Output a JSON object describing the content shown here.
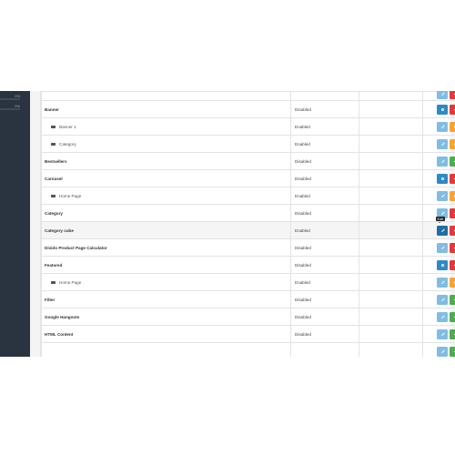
{
  "sidebar": {
    "progress": [
      {
        "label": "0%",
        "value": 0
      },
      {
        "label": "0%",
        "value": 0
      }
    ]
  },
  "modules": [
    {
      "name": "",
      "status": "",
      "type": "top",
      "buttons": [
        "edit",
        "uninstall"
      ]
    },
    {
      "name": "Banner",
      "status": "Disabled",
      "type": "module",
      "buttons": [
        "add",
        "uninstall"
      ]
    },
    {
      "name": "Banner 1",
      "status": "Enabled",
      "type": "child",
      "buttons": [
        "edit",
        "delete"
      ]
    },
    {
      "name": "Category",
      "status": "Enabled",
      "type": "child",
      "buttons": [
        "edit",
        "delete"
      ]
    },
    {
      "name": "Bestsellers",
      "status": "Disabled",
      "type": "module",
      "buttons": [
        "edit",
        "install"
      ]
    },
    {
      "name": "Carousel",
      "status": "Disabled",
      "type": "module",
      "buttons": [
        "add",
        "uninstall"
      ]
    },
    {
      "name": "Home Page",
      "status": "Enabled",
      "type": "child",
      "buttons": [
        "edit",
        "delete"
      ]
    },
    {
      "name": "Category",
      "status": "Disabled",
      "type": "module",
      "buttons": [
        "edit",
        "uninstall"
      ]
    },
    {
      "name": "Category cube",
      "status": "Enabled",
      "type": "module",
      "highlight": true,
      "tooltip": "Edit",
      "buttons": [
        "edit-active",
        "uninstall"
      ]
    },
    {
      "name": "Divido Product Page Calculator",
      "status": "Disabled",
      "type": "module",
      "buttons": [
        "edit",
        "uninstall"
      ]
    },
    {
      "name": "Featured",
      "status": "Disabled",
      "type": "module",
      "buttons": [
        "add",
        "uninstall"
      ]
    },
    {
      "name": "Home Page",
      "status": "Enabled",
      "type": "child",
      "buttons": [
        "edit",
        "delete"
      ]
    },
    {
      "name": "Filter",
      "status": "Disabled",
      "type": "module",
      "buttons": [
        "edit",
        "install"
      ]
    },
    {
      "name": "Google Hangouts",
      "status": "Disabled",
      "type": "module",
      "buttons": [
        "edit",
        "install"
      ]
    },
    {
      "name": "HTML Content",
      "status": "Disabled",
      "type": "module",
      "buttons": [
        "edit",
        "install"
      ]
    },
    {
      "name": "",
      "status": "",
      "type": "module",
      "buttons": [
        "edit",
        "install"
      ]
    }
  ],
  "colors": {
    "sidebar_bg": "#2a3440",
    "edit_button": "#7fbde4",
    "add_button": "#2b8bc8",
    "active_edit_button": "#1d6fa5",
    "uninstall_button": "#e53935",
    "delete_button": "#f7a531",
    "install_button": "#4cae4c"
  }
}
